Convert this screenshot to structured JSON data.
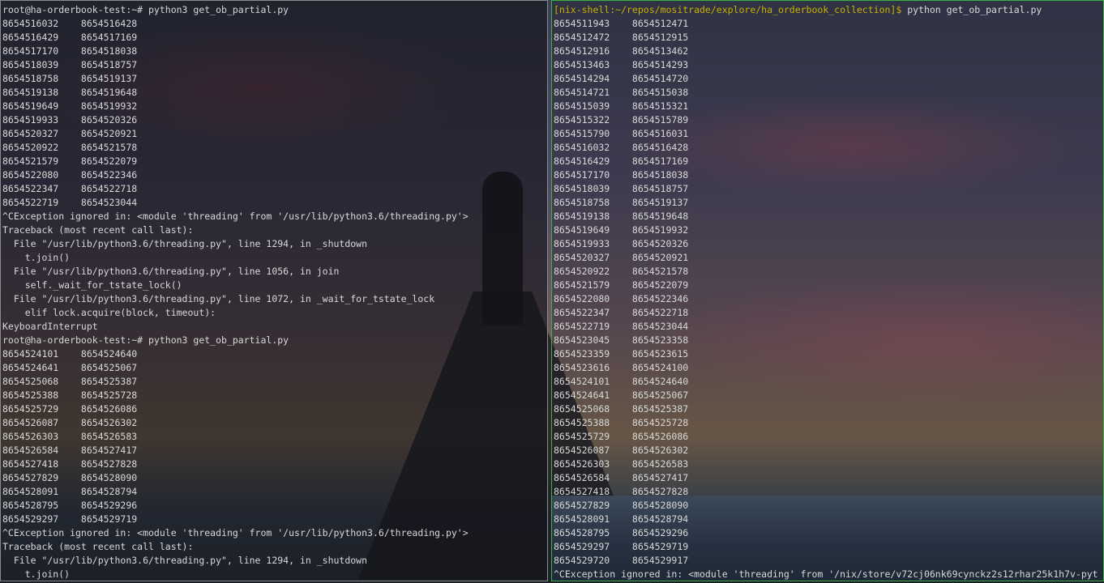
{
  "left_pane": {
    "lines": [
      "root@ha-orderbook-test:~# python3 get_ob_partial.py",
      "8654516032    8654516428",
      "8654516429    8654517169",
      "8654517170    8654518038",
      "8654518039    8654518757",
      "8654518758    8654519137",
      "8654519138    8654519648",
      "8654519649    8654519932",
      "8654519933    8654520326",
      "8654520327    8654520921",
      "8654520922    8654521578",
      "8654521579    8654522079",
      "8654522080    8654522346",
      "8654522347    8654522718",
      "8654522719    8654523044",
      "^CException ignored in: <module 'threading' from '/usr/lib/python3.6/threading.py'>",
      "Traceback (most recent call last):",
      "  File \"/usr/lib/python3.6/threading.py\", line 1294, in _shutdown",
      "    t.join()",
      "  File \"/usr/lib/python3.6/threading.py\", line 1056, in join",
      "    self._wait_for_tstate_lock()",
      "  File \"/usr/lib/python3.6/threading.py\", line 1072, in _wait_for_tstate_lock",
      "    elif lock.acquire(block, timeout):",
      "KeyboardInterrupt",
      "root@ha-orderbook-test:~# python3 get_ob_partial.py",
      "8654524101    8654524640",
      "8654524641    8654525067",
      "8654525068    8654525387",
      "8654525388    8654525728",
      "8654525729    8654526086",
      "8654526087    8654526302",
      "8654526303    8654526583",
      "8654526584    8654527417",
      "8654527418    8654527828",
      "8654527829    8654528090",
      "8654528091    8654528794",
      "8654528795    8654529296",
      "8654529297    8654529719",
      "^CException ignored in: <module 'threading' from '/usr/lib/python3.6/threading.py'>",
      "Traceback (most recent call last):",
      "  File \"/usr/lib/python3.6/threading.py\", line 1294, in _shutdown",
      "    t.join()"
    ]
  },
  "right_pane": {
    "prompt": "[nix-shell:~/repos/mositrade/explore/ha_orderbook_collection]$",
    "command": " python get_ob_partial.py",
    "lines": [
      "8654511943    8654512471",
      "8654512472    8654512915",
      "8654512916    8654513462",
      "8654513463    8654514293",
      "8654514294    8654514720",
      "8654514721    8654515038",
      "8654515039    8654515321",
      "8654515322    8654515789",
      "8654515790    8654516031",
      "8654516032    8654516428",
      "8654516429    8654517169",
      "8654517170    8654518038",
      "8654518039    8654518757",
      "8654518758    8654519137",
      "8654519138    8654519648",
      "8654519649    8654519932",
      "8654519933    8654520326",
      "8654520327    8654520921",
      "8654520922    8654521578",
      "8654521579    8654522079",
      "8654522080    8654522346",
      "8654522347    8654522718",
      "8654522719    8654523044",
      "8654523045    8654523358",
      "8654523359    8654523615",
      "8654523616    8654524100",
      "8654524101    8654524640",
      "8654524641    8654525067",
      "8654525068    8654525387",
      "8654525388    8654525728",
      "8654525729    8654526086",
      "8654526087    8654526302",
      "8654526303    8654526583",
      "8654526584    8654527417",
      "8654527418    8654527828",
      "8654527829    8654528090",
      "8654528091    8654528794",
      "8654528795    8654529296",
      "8654529297    8654529719",
      "8654529720    8654529917",
      "^CException ignored in: <module 'threading' from '/nix/store/v72cj06nk69cynckz2s12rhar25k1h7v-pyt"
    ]
  },
  "colors": {
    "left_border": "#8a8a8a",
    "right_border": "#3cb043",
    "nix_prompt": "#c9b300",
    "text": "#d9d9d9"
  }
}
